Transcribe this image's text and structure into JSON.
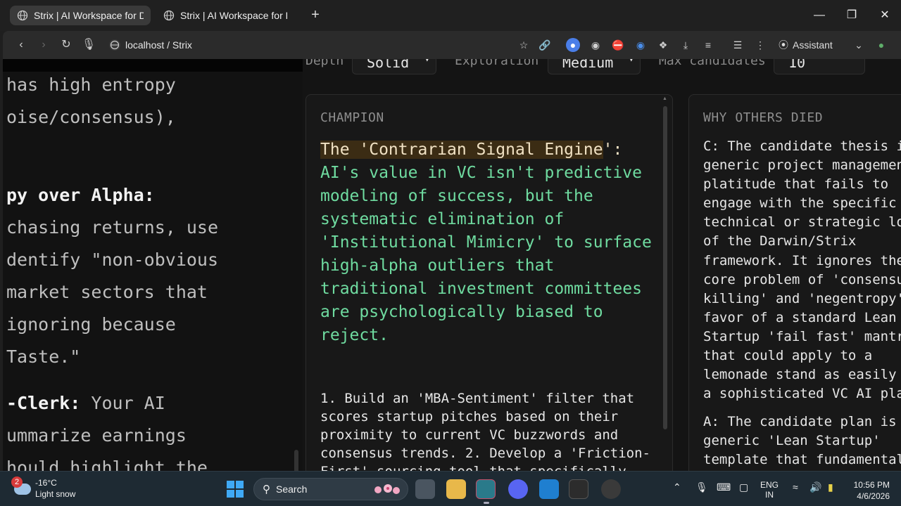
{
  "browser": {
    "tabs": [
      {
        "title": "Strix | AI Workspace for De",
        "active": true
      },
      {
        "title": "Strix | AI Workspace for De",
        "active": false
      }
    ],
    "address": "localhost / Strix",
    "assistant_label": "Assistant"
  },
  "left_pane": {
    "lines": [
      {
        "text": "has high entropy",
        "bold": ""
      },
      {
        "text": "oise/consensus),",
        "bold": ""
      },
      {
        "text": "",
        "bold": "py over Alpha:"
      },
      {
        "text": "chasing returns, use",
        "bold": ""
      },
      {
        "text": "dentify \"non-obvious",
        "bold": ""
      },
      {
        "text": "market sectors that",
        "bold": ""
      },
      {
        "text": "ignoring because",
        "bold": ""
      },
      {
        "text": "Taste.\"",
        "bold": ""
      },
      {
        "text": " Your AI",
        "bold": "-Clerk:"
      },
      {
        "text": "ummarize earnings",
        "bold": ""
      },
      {
        "text": "hould highlight the",
        "bold": ""
      }
    ]
  },
  "controls": {
    "depth_label": "Depth",
    "depth_value": "Solid",
    "exploration_label": "Exploration",
    "exploration_value": "Medium",
    "max_candidates_label": "Max candidates",
    "max_candidates_value": "10"
  },
  "champion": {
    "heading": "CHAMPION",
    "lead_highlight": "The 'Contrarian Signal Engine",
    "lead_highlight_tail": "'",
    "lead_colon": ":",
    "lead_rest": "AI's value in VC isn't predictive modeling of success, but the systematic elimination of 'Institutional Mimicry' to surface high-alpha outliers that traditional investment committees are psychologically biased to reject.",
    "body": "1. Build an 'MBA-Sentiment' filter that scores startup pitches based on their proximity to current VC buzzwords and consensus trends. 2. Develop a 'Friction-First' sourcing tool that specifically targets founders in non-"
  },
  "why_others_died": {
    "heading": "WHY OTHERS DIED",
    "entries": [
      {
        "tag": "C:",
        "lines": [
          "C: The candidate thesis is",
          "generic project management",
          "platitude that fails to",
          "engage with the specific",
          "technical or strategic log",
          "of the Darwin/Strix",
          "framework. It ignores the",
          "core problem of 'consensus",
          "killing' and 'negentropy'",
          "favor of a standard Lean",
          "Startup 'fail fast' mantra",
          "that could apply to a",
          "lemonade stand as easily a",
          "a sophisticated VC AI play"
        ]
      },
      {
        "tag": "A:",
        "lines": [
          "A: The candidate plan is a",
          "generic 'Lean Startup'",
          "template that fundamentall"
        ]
      }
    ]
  },
  "taskbar": {
    "weather_badge": "2",
    "temperature": "-16°C",
    "condition": "Light snow",
    "search_label": "Search",
    "lang_1": "ENG",
    "lang_2": "IN",
    "time": "10:56 PM",
    "date": "4/6/2026"
  }
}
